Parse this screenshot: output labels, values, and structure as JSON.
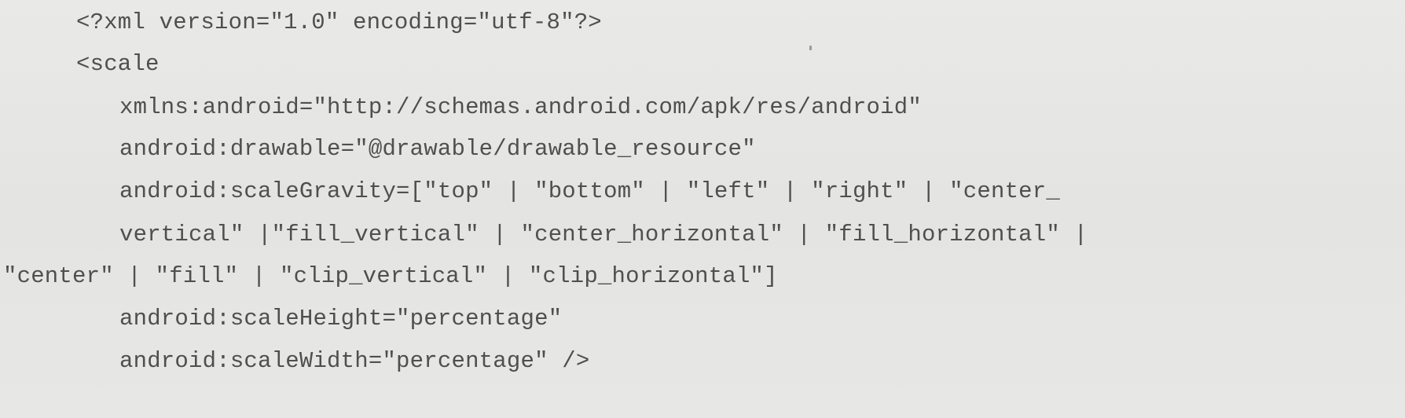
{
  "code": {
    "lines": [
      "<?xml version=\"1.0\" encoding=\"utf-8\"?>",
      "<scale",
      "xmlns:android=\"http://schemas.android.com/apk/res/android\"",
      "android:drawable=\"@drawable/drawable_resource\"",
      "android:scaleGravity=[\"top\" | \"bottom\" | \"left\" | \"right\" | \"center_",
      "vertical\" |\"fill_vertical\" | \"center_horizontal\" | \"fill_horizontal\" |",
      "\"center\" | \"fill\" | \"clip_vertical\" | \"clip_horizontal\"]",
      "android:scaleHeight=\"percentage\"",
      "android:scaleWidth=\"percentage\" />"
    ]
  },
  "colors": {
    "background": "#e6e6e4",
    "text": "#4f4f4f"
  }
}
